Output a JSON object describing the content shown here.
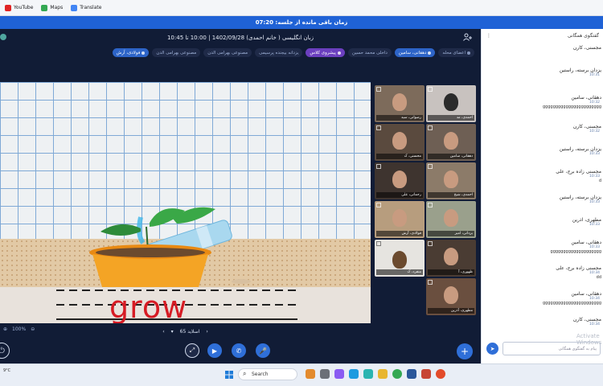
{
  "browser": {
    "bookmarks": [
      {
        "label": "YouTube",
        "color": "#e02424"
      },
      {
        "label": "Maps",
        "color": "#34a853"
      },
      {
        "label": "Translate",
        "color": "#4285f4"
      }
    ]
  },
  "session": {
    "timer_text": "زمان باقی مانده از جلسه: 07:20"
  },
  "classroom": {
    "title": "زبان انگلیسی ( خانم احمدی) 1402/09/28 | 10:00 تا 10:45",
    "tabs": [
      {
        "label": "اعضای محله",
        "style": "normal"
      },
      {
        "label": "دهقانی، سامین",
        "style": "active2"
      },
      {
        "label": "داخلی محمد حسین",
        "style": "normal"
      },
      {
        "label": "پیشروی کلاس",
        "style": "active"
      },
      {
        "label": "یزدانه بیجنده پرسیمی",
        "style": "normal"
      },
      {
        "label": "مصنوعی بهرامی الدن",
        "style": "normal"
      },
      {
        "label": "مصنوعی بهرامی الدن",
        "style": "normal"
      },
      {
        "label": "فولادی، آرش",
        "style": "active2"
      }
    ],
    "slide": {
      "word": "grow",
      "page_label": "اسلاید 65",
      "zoom_label": "100%"
    },
    "participants": [
      {
        "name": "رضوانی، سید"
      },
      {
        "name": "احمدی، مد"
      },
      {
        "name": "محسنی، ک"
      },
      {
        "name": "دهقانی، سامین"
      },
      {
        "name": "رحمانی، علی"
      },
      {
        "name": "احمدی، شیخ"
      },
      {
        "name": "فولادی، آرش"
      },
      {
        "name": "یزدانی، امیر"
      },
      {
        "name": "منفرد، ک"
      },
      {
        "name": "ظهوری، آ"
      },
      {
        "name": "مطهری، آذرین"
      },
      {
        "name": "یوسفی، ک"
      },
      {
        "name": "زمانه پرسیمی"
      }
    ]
  },
  "chat": {
    "title": "گفتگوی همگانی",
    "messages": [
      {
        "name": "مجسنی، کارن",
        "time": "",
        "text": ""
      },
      {
        "name": "یزدان برسته، راستین",
        "time": "10:31",
        "text": ""
      },
      {
        "name": "دهقانی، سامین",
        "time": "10:32",
        "text": "ggggggggggggggggggggggg"
      },
      {
        "name": "مجسنی، کارن",
        "time": "10:32",
        "text": ""
      },
      {
        "name": "یزدان برسته، راستین",
        "time": "10:33",
        "text": ""
      },
      {
        "name": "مجسنی زاده برج، علی",
        "time": "10:33",
        "text": "d"
      },
      {
        "name": "یزدان برسته، راستین",
        "time": "10:33",
        "text": ""
      },
      {
        "name": "مطهری، آذرین",
        "time": "10:33",
        "text": ""
      },
      {
        "name": "دهقانی، سامین",
        "time": "10:33",
        "text": "gggggggggggggggggggg"
      },
      {
        "name": "مجسنی زاده برج، علی",
        "time": "10:34",
        "text": "dd"
      },
      {
        "name": "دهقانی، سامین",
        "time": "10:34",
        "text": "ggggggggggggggggggggggg"
      },
      {
        "name": "مجسنی، کارن",
        "time": "10:34",
        "text": ""
      }
    ],
    "input_placeholder": "پیام به گفتگوی همگانی",
    "watermark": "Activate Windows"
  },
  "taskbar": {
    "weather": "9°C",
    "search_label": "Search"
  },
  "colors": {
    "accent": "#1f62d6",
    "call_button": "#2f6fd8",
    "tab_active": "#6b3fbf",
    "word_color": "#d61b24"
  }
}
